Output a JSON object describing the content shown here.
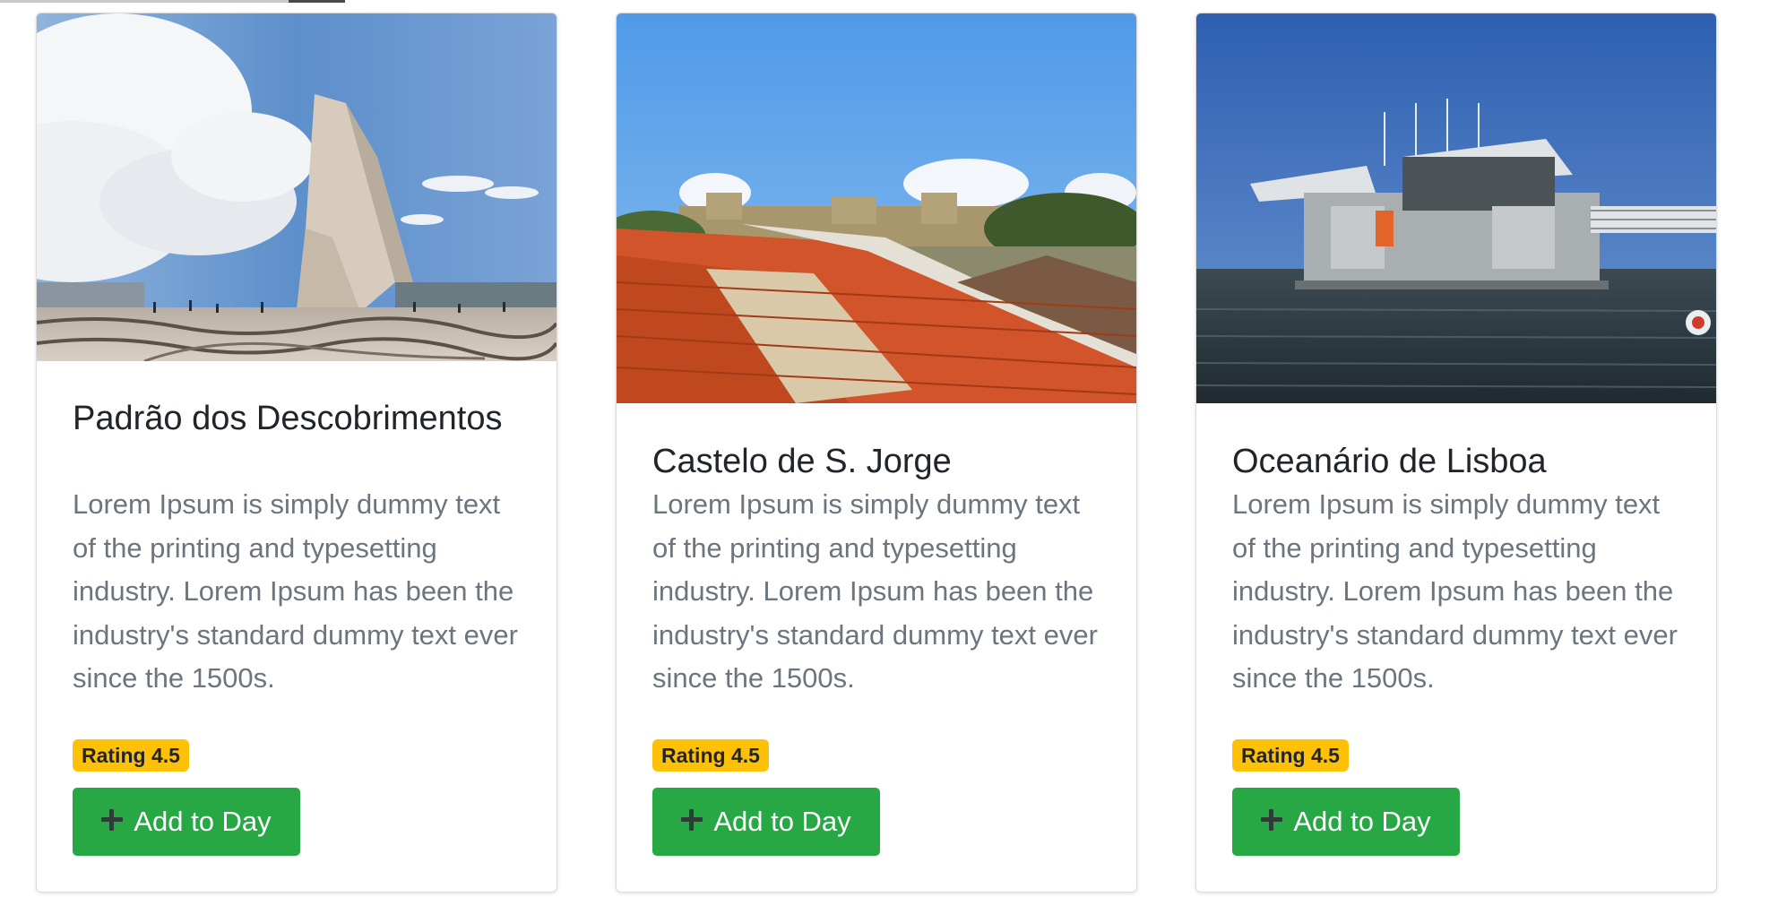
{
  "cards": [
    {
      "title": "Padrão dos Descobrimentos",
      "description": "Lorem Ipsum is simply dummy text of the printing and typesetting industry. Lorem Ipsum has been the industry's standard dummy text ever since the 1500s.",
      "rating_label": "Rating 4.5",
      "button_label": "Add to Day",
      "button_icon": "plus-icon"
    },
    {
      "title": "Castelo de S. Jorge",
      "description": "Lorem Ipsum is simply dummy text of the printing and typesetting industry. Lorem Ipsum has been the industry's standard dummy text ever since the 1500s.",
      "rating_label": "Rating 4.5",
      "button_label": "Add to Day",
      "button_icon": "plus-icon"
    },
    {
      "title": "Oceanário de Lisboa",
      "description": "Lorem Ipsum is simply dummy text of the printing and typesetting industry. Lorem Ipsum has been the industry's standard dummy text ever since the 1500s.",
      "rating_label": "Rating 4.5",
      "button_label": "Add to Day",
      "button_icon": "plus-icon"
    }
  ],
  "colors": {
    "badge": "#ffc107",
    "button": "#28a745",
    "title": "#212529",
    "body_text": "#6c757d"
  }
}
